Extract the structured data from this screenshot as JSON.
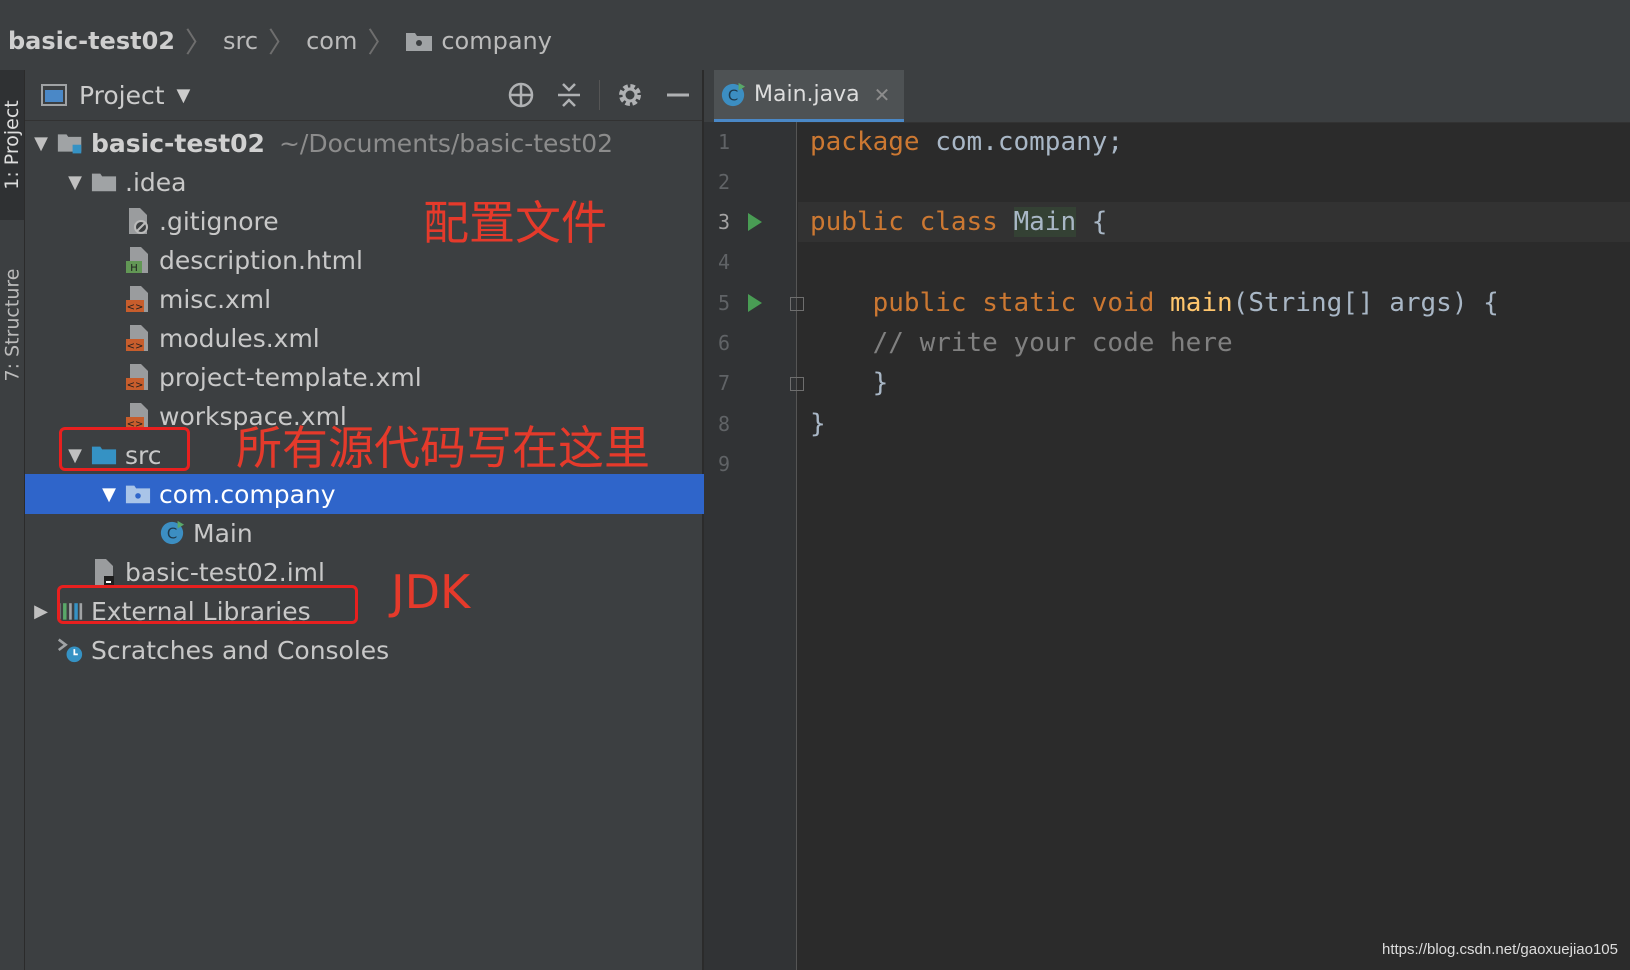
{
  "navbar": {
    "crumbs": [
      "basic-test02",
      "src",
      "com",
      "company"
    ]
  },
  "left_tool_tabs": [
    "1: Project",
    "7: Structure"
  ],
  "project_panel": {
    "title": "Project",
    "tree": [
      {
        "label": "basic-test02",
        "hint": "~/Documents/basic-test02"
      },
      {
        "label": ".idea"
      },
      {
        "label": ".gitignore"
      },
      {
        "label": "description.html"
      },
      {
        "label": "misc.xml"
      },
      {
        "label": "modules.xml"
      },
      {
        "label": "project-template.xml"
      },
      {
        "label": "workspace.xml"
      },
      {
        "label": "src"
      },
      {
        "label": "com.company"
      },
      {
        "label": "Main"
      },
      {
        "label": "basic-test02.iml"
      },
      {
        "label": "External Libraries"
      },
      {
        "label": "Scratches and Consoles"
      }
    ]
  },
  "annotations": {
    "config": "配置文件",
    "source": "所有源代码写在这里",
    "jdk": "JDK"
  },
  "editor": {
    "tab_label": "Main.java",
    "line_numbers": [
      "1",
      "2",
      "3",
      "4",
      "5",
      "6",
      "7",
      "8",
      "9"
    ],
    "code": {
      "l1_kw": "package",
      "l1_rest": " com.company;",
      "l3_kw": "public class",
      "l3_cls": "Main",
      "l3_rest": " {",
      "l5_indent": "    ",
      "l5_kw": "public static void",
      "l5_fn": "main",
      "l5_rest": "(String[] args) {",
      "l6_comment": "    // write your code here",
      "l7": "    }",
      "l8": "}"
    }
  },
  "watermark": "https://blog.csdn.net/gaoxuejiao105",
  "colors": {
    "selection": "#2f65ca",
    "annotation": "#e53a2b",
    "keyword": "#cc7832",
    "function": "#ffc66d",
    "comment": "#808080"
  }
}
